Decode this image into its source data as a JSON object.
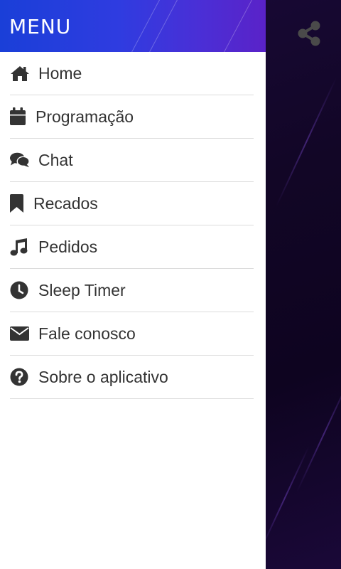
{
  "drawer": {
    "title": "MENU",
    "items": [
      {
        "label": "Home",
        "icon": "home-icon"
      },
      {
        "label": "Programação",
        "icon": "calendar-icon"
      },
      {
        "label": "Chat",
        "icon": "chat-icon"
      },
      {
        "label": "Recados",
        "icon": "bookmark-icon"
      },
      {
        "label": "Pedidos",
        "icon": "music-note-icon"
      },
      {
        "label": "Sleep Timer",
        "icon": "clock-icon"
      },
      {
        "label": "Fale conosco",
        "icon": "envelope-icon"
      },
      {
        "label": "Sobre o aplicativo",
        "icon": "question-circle-icon"
      }
    ]
  },
  "topbar": {
    "share_icon": "share-icon"
  },
  "colors": {
    "header_start": "#1a3fd8",
    "header_end": "#5a22c8",
    "icon_color": "#333333",
    "background": "#120626"
  }
}
